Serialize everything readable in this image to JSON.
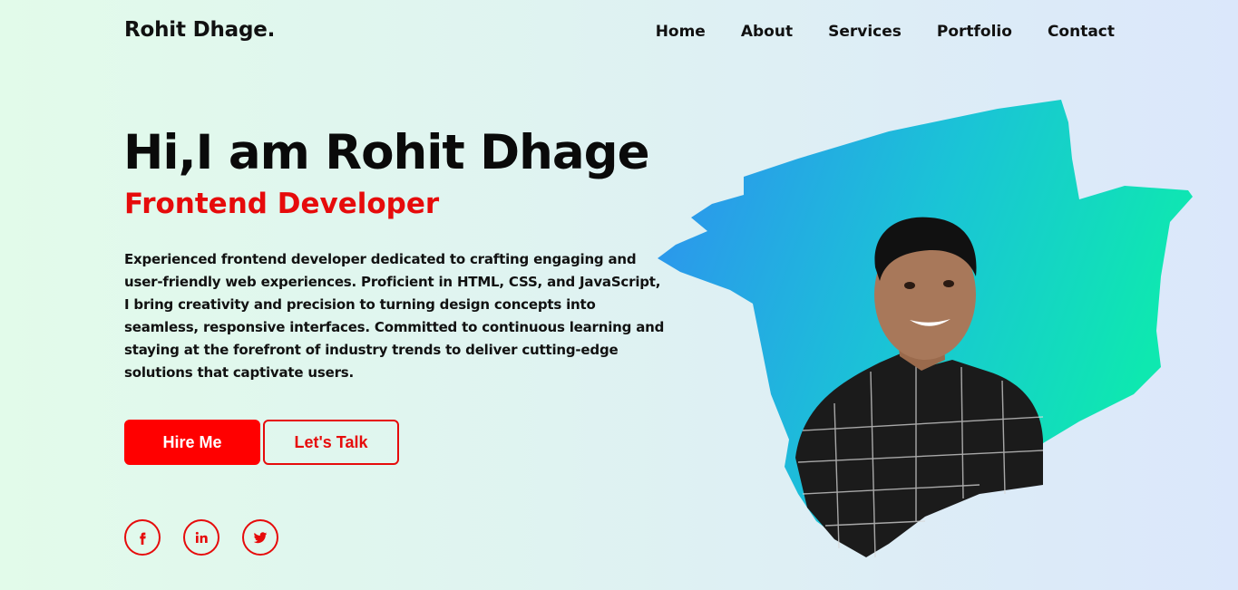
{
  "header": {
    "logo": "Rohit Dhage.",
    "nav": [
      {
        "label": "Home"
      },
      {
        "label": "About"
      },
      {
        "label": "Services"
      },
      {
        "label": "Portfolio"
      },
      {
        "label": "Contact"
      }
    ]
  },
  "hero": {
    "title": "Hi,I am Rohit Dhage",
    "role": "Frontend Developer",
    "description": "Experienced frontend developer dedicated to crafting engaging and user-friendly web experiences. Proficient in HTML, CSS, and JavaScript, I bring creativity and precision to turning design concepts into seamless, responsive interfaces. Committed to continuous learning and staying at the forefront of industry trends to deliver cutting-edge solutions that captivate users.",
    "hire_label": "Hire Me",
    "talk_label": "Let's Talk"
  },
  "social": [
    {
      "icon": "facebook-icon"
    },
    {
      "icon": "linkedin-icon"
    },
    {
      "icon": "twitter-icon"
    }
  ],
  "colors": {
    "accent": "#ff0000",
    "text": "#111111",
    "brush_start": "#2f8ff0",
    "brush_end": "#0ee8b0"
  }
}
